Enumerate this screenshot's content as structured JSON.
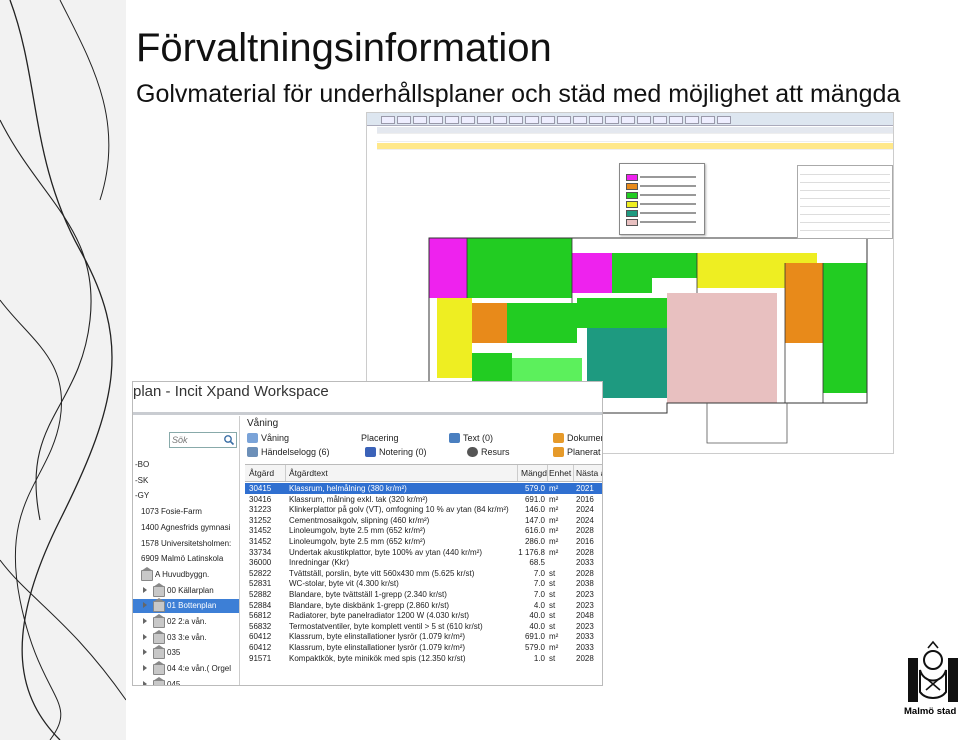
{
  "slide": {
    "title": "Förvaltningsinformation",
    "subtitle": "Golvmaterial för underhållsplaner och städ med möjlighet att mängda"
  },
  "workspace": {
    "title": "plan - Incit Xpand Workspace",
    "search_placeholder": "Sök",
    "tree": [
      {
        "label": "-BO",
        "type": "text"
      },
      {
        "label": "-SK",
        "type": "text"
      },
      {
        "label": "-GY",
        "type": "text"
      },
      {
        "label": "1073 Fosie-Farm",
        "type": "node"
      },
      {
        "label": "1400 Agnesfrids gymnasi",
        "type": "node"
      },
      {
        "label": "1578 Universitetsholmen:",
        "type": "node"
      },
      {
        "label": "6909 Malmö Latinskola",
        "type": "node"
      },
      {
        "label": "A Huvudbyggn.",
        "type": "building"
      },
      {
        "label": "00 Källarplan",
        "type": "floor"
      },
      {
        "label": "01 Bottenplan",
        "type": "floor",
        "selected": true
      },
      {
        "label": "02 2:a vån.",
        "type": "floor"
      },
      {
        "label": "03 3:e vån.",
        "type": "floor"
      },
      {
        "label": "035",
        "type": "floor"
      },
      {
        "label": "04 4:e vån.( Orgel",
        "type": "floor"
      },
      {
        "label": "045",
        "type": "floor"
      }
    ],
    "section_label": "Våning",
    "toolbar": {
      "vaning": "Våning",
      "placering": "Placering",
      "text": "Text (0)",
      "dokument": "Dokumen",
      "handelselogg": "Händelselogg (6)",
      "notering": "Notering (0)",
      "resurs": "Resurs",
      "planerat": "Planerat u"
    },
    "columns": [
      "Åtgärd",
      "Åtgärdtext",
      "Mängd",
      "Enhet",
      "Nästa å"
    ],
    "rows": [
      {
        "code": "30415",
        "text": "Klassrum, helmålning (380 kr/m²)",
        "qty": "579.0",
        "unit": "m²",
        "year": "2021",
        "selected": true
      },
      {
        "code": "30416",
        "text": "Klassrum, målning exkl. tak (320 kr/m²)",
        "qty": "691.0",
        "unit": "m²",
        "year": "2016"
      },
      {
        "code": "31223",
        "text": "Klinkerplattor på golv (VT), omfogning 10 % av ytan (84 kr/m²)",
        "qty": "146.0",
        "unit": "m²",
        "year": "2024"
      },
      {
        "code": "31252",
        "text": "Cementmosaikgolv, slipning (460 kr/m²)",
        "qty": "147.0",
        "unit": "m²",
        "year": "2024"
      },
      {
        "code": "31452",
        "text": "Linoleumgolv, byte 2.5 mm (652 kr/m²)",
        "qty": "616.0",
        "unit": "m²",
        "year": "2028"
      },
      {
        "code": "31452",
        "text": "Linoleumgolv, byte 2.5 mm (652 kr/m²)",
        "qty": "286.0",
        "unit": "m²",
        "year": "2016"
      },
      {
        "code": "33734",
        "text": "Undertak akustikplattor, byte 100% av ytan (440 kr/m²)",
        "qty": "1 176.8",
        "unit": "m²",
        "year": "2028"
      },
      {
        "code": "36000",
        "text": "Inredningar (Kkr)",
        "qty": "68.5",
        "unit": "",
        "year": "2033"
      },
      {
        "code": "52822",
        "text": "Tvättställ, porslin, byte vitt 560x430 mm (5.625 kr/st)",
        "qty": "7.0",
        "unit": "st",
        "year": "2028"
      },
      {
        "code": "52831",
        "text": "WC-stolar, byte vit (4.300 kr/st)",
        "qty": "7.0",
        "unit": "st",
        "year": "2038"
      },
      {
        "code": "52882",
        "text": "Blandare, byte tvättställ 1-grepp (2.340 kr/st)",
        "qty": "7.0",
        "unit": "st",
        "year": "2023"
      },
      {
        "code": "52884",
        "text": "Blandare, byte diskbänk 1-grepp (2.860 kr/st)",
        "qty": "4.0",
        "unit": "st",
        "year": "2023"
      },
      {
        "code": "56812",
        "text": "Radiatorer, byte panelradiator 1200 W (4.030 kr/st)",
        "qty": "40.0",
        "unit": "st",
        "year": "2048"
      },
      {
        "code": "56832",
        "text": "Termostatventiler, byte komplett ventil > 5 st (610 kr/st)",
        "qty": "40.0",
        "unit": "st",
        "year": "2023"
      },
      {
        "code": "60412",
        "text": "Klassrum, byte elinstallationer lysrör (1.079 kr/m²)",
        "qty": "691.0",
        "unit": "m²",
        "year": "2033"
      },
      {
        "code": "60412",
        "text": "Klassrum, byte elinstallationer lysrör (1.079 kr/m²)",
        "qty": "579.0",
        "unit": "m²",
        "year": "2033"
      },
      {
        "code": "91571",
        "text": "Kompaktkök, byte minikök med spis (12.350 kr/st)",
        "qty": "1.0",
        "unit": "st",
        "year": "2028"
      }
    ]
  },
  "logo": {
    "text": "Malmö stad"
  },
  "colors": {
    "accent_selection": "#2f6fd0",
    "room_green": "#22cc22",
    "room_magenta": "#ee22ee",
    "room_yellow": "#eeee22",
    "room_orange": "#e88a1a",
    "room_teal": "#1e9a80",
    "room_pink": "#e8c0c0",
    "room_lightgreen": "#5cf05c"
  }
}
